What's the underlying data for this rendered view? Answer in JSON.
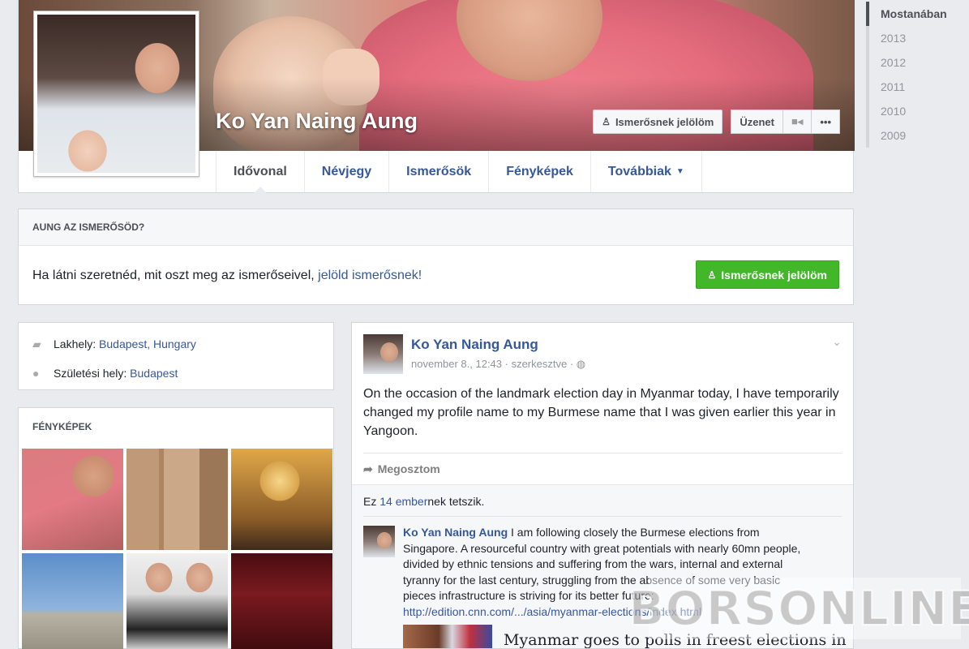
{
  "profile": {
    "name": "Ko Yan Naing Aung",
    "buttons": {
      "add_friend": "Ismerősnek jelölöm",
      "message": "Üzenet",
      "more": "•••"
    },
    "tabs": [
      {
        "label": "Idővonal",
        "active": true
      },
      {
        "label": "Névjegy"
      },
      {
        "label": "Ismerősök"
      },
      {
        "label": "Fényképek"
      },
      {
        "label": "Továbbiak"
      }
    ]
  },
  "timeline_years": [
    "Mostanában",
    "2013",
    "2012",
    "2011",
    "2010",
    "2009"
  ],
  "friend_prompt": {
    "heading": "AUNG AZ ISMERŐSÖD?",
    "text": "Ha látni szeretnéd, mit oszt meg az ismerőseivel, ",
    "link": "jelöld ismerősnek!",
    "button": "Ismerősnek jelölöm"
  },
  "intro": {
    "lives_label": "Lakhely: ",
    "lives_value": "Budapest, Hungary",
    "born_label": "Születési hely: ",
    "born_value": "Budapest"
  },
  "photos": {
    "heading": "FÉNYKÉPEK"
  },
  "post": {
    "author": "Ko Yan Naing Aung",
    "meta": "november 8., 12:43 · szerkesztve · ",
    "globe_icon": "globe-icon",
    "text": "On the occasion of the landmark election day in Myanmar today, I have temporarily changed my profile name to my Burmese name that I was given earlier this year in Yangoon.",
    "share_label": "Megosztom",
    "likes_prefix": "Ez ",
    "likes_count": "14 ember",
    "likes_suffix": "nek tetszik.",
    "comment": {
      "author": "Ko Yan Naing Aung",
      "text": " I am following closely the Burmese elections from Singapore. A resourceful country with great potentials with nearly 60mn people, divided by ethnic tensions and suffering from the wars, internal and external tyranny for the last century, struggling from the absence of some very basic pieces infrastructure is striving for its better future:",
      "link": "http://edition.cnn.com/.../asia/myanmar-elections/index.html"
    },
    "link_preview_title": "Myanmar goes to polls in freest elections in"
  },
  "watermark": "BORSONLINE",
  "colors": {
    "link": "#365899",
    "green_button": "#42b72a",
    "page_bg": "#e9ebee"
  }
}
